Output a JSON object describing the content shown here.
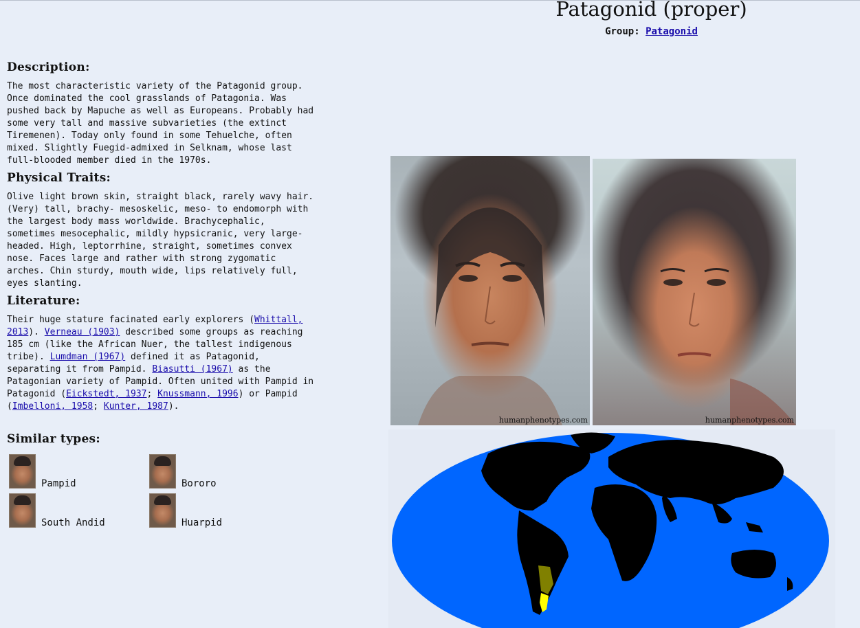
{
  "title": "Patagonid (proper)",
  "group": {
    "label": "Group:",
    "link": "Patagonid"
  },
  "description": {
    "heading": "Description:",
    "text": "The most characteristic variety of the Patagonid group. Once dominated the cool grasslands of Patagonia. Was pushed back by Mapuche as well as Europeans. Probably had some very tall and massive subvarieties (the extinct Tiremenen). Today only found in some Tehuelche, often mixed. Slightly Fuegid-admixed in Selknam, whose last full-blooded member died in the 1970s."
  },
  "physical_traits": {
    "heading": "Physical Traits:",
    "text": "Olive light brown skin, straight black, rarely wavy hair. (Very) tall, brachy- mesoskelic, meso- to endomorph with the largest body mass worldwide. Brachycephalic, sometimes mesocephalic, mildly hypsicranic, very large-headed. High, leptorrhine, straight, sometimes convex nose. Faces large and rather with strong zygomatic arches. Chin sturdy, mouth wide, lips relatively full, eyes slanting."
  },
  "literature": {
    "heading": "Literature:",
    "t1": "Their huge stature facinated early explorers (",
    "l1": "Whittall, 2013",
    "t2": "). ",
    "l2": "Verneau (1903)",
    "t3": " described some groups as reaching 185 cm (like the African Nuer, the tallest indigenous tribe). ",
    "l3": "Lumdman (1967)",
    "t4": " defined it as Patagonid, separating it from Pampid. ",
    "l4": "Biasutti (1967)",
    "t5": " as the Patagonian variety of Pampid. Often united with Pampid in Patagonid (",
    "l5": "Eickstedt, 1937",
    "t6": "; ",
    "l6": "Knussmann, 1996",
    "t7": ") or Pampid (",
    "l7": "Imbelloni, 1958",
    "t8": "; ",
    "l8": "Kunter, 1987",
    "t9": ")."
  },
  "similar": {
    "heading": "Similar types:",
    "items": [
      {
        "label": "Pampid"
      },
      {
        "label": "Bororo"
      },
      {
        "label": "South Andid"
      },
      {
        "label": "Huarpid"
      }
    ]
  },
  "photos": {
    "watermark": "humanphenotypes.com"
  },
  "map": {
    "ocean_color": "#0066ff",
    "land_color": "#000000",
    "range_color": "#808000",
    "core_color": "#ffff00"
  }
}
